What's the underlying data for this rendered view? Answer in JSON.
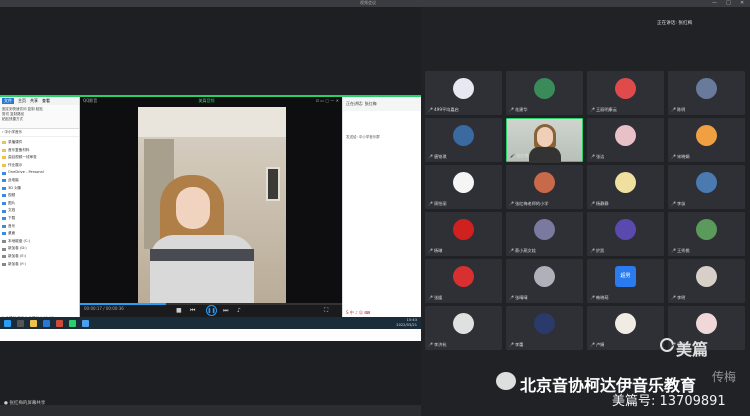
{
  "window": {
    "title": "视频会议",
    "controls": [
      "—",
      "□",
      "✕"
    ]
  },
  "explorer": {
    "tabs": [
      "文件",
      "主页",
      "共享",
      "查看"
    ],
    "ribbon_items": [
      "固定到快速访问",
      "复制",
      "粘贴",
      "剪切",
      "复制路径",
      "粘贴快捷方式"
    ],
    "address": "› 中小学音乐",
    "nav": [
      "录播课件",
      "音乐复备材料",
      "曲目视频一线审查",
      "作业展示",
      "OneDrive - Personal",
      "此电脑",
      "3D 对象",
      "视频",
      "图片",
      "文档",
      "下载",
      "音乐",
      "桌面",
      "本地磁盘 (C:)",
      "新加卷 (D:)",
      "新加卷 (E:)",
      "新加卷 (F:)"
    ],
    "status": "2 个项目  选中 1 个项目  1.05 GB"
  },
  "player": {
    "name": "QQ影音",
    "title": "美篇音频",
    "time": "00:00:17 / 00:00:36",
    "progress": 0.33
  },
  "chat": {
    "header": "正在讲话: 张红梅",
    "message": "发送给: 中小学音乐群",
    "tray": "S 中 ♪ ☺ ⌨"
  },
  "taskbar": {
    "time": "15:43",
    "date": "2022/03/21"
  },
  "presenter": "张红梅的屏幕共享",
  "meeting": {
    "speaking": "正在讲话: 张红梅",
    "participants": [
      {
        "name": "499平均嘉启",
        "color": "#e8e8f0"
      },
      {
        "name": "花建华",
        "color": "#3a8a5a"
      },
      {
        "name": "王丽明康云",
        "color": "#e04a4a"
      },
      {
        "name": "陈明",
        "color": "#6a7a9a"
      },
      {
        "name": "唐铭琪",
        "color": "#3a6aa0"
      },
      {
        "name": "张红梅",
        "color": "",
        "camera": true
      },
      {
        "name": "张洁",
        "color": "#e8c0c8"
      },
      {
        "name": "宋晓娟",
        "color": "#f0a040"
      },
      {
        "name": "周怡丽",
        "color": "#f5f5f5"
      },
      {
        "name": "张红梅老师的小学",
        "color": "#c86a4a"
      },
      {
        "name": "杨静静",
        "color": "#f0e0a0"
      },
      {
        "name": "李苗",
        "color": "#4a7ab0"
      },
      {
        "name": "杨琳",
        "color": "#d02020"
      },
      {
        "name": "蔡小燕文娃",
        "color": "#7a7aa0"
      },
      {
        "name": "於凯",
        "color": "#5a4ab0"
      },
      {
        "name": "王秀桃",
        "color": "#5a9a5a"
      },
      {
        "name": "张媛",
        "color": "#d83030"
      },
      {
        "name": "张晴晴",
        "color": "#b0b0b8"
      },
      {
        "name": "韩晓萌",
        "color": "#2a7af0",
        "label": "超男"
      },
      {
        "name": "李明",
        "color": "#d8d0c8"
      },
      {
        "name": "李济杭",
        "color": "#e0e0e0"
      },
      {
        "name": "李蕾",
        "color": "#2a3a6a"
      },
      {
        "name": "卢娟",
        "color": "#f0ece4"
      },
      {
        "name": "马丽",
        "color": "#f0d8d8"
      }
    ]
  },
  "watermark": {
    "brand": "美篇",
    "org": "北京音协柯达伊音乐教育",
    "id": "美篇号: 13709891",
    "name_fragment": "传梅"
  }
}
